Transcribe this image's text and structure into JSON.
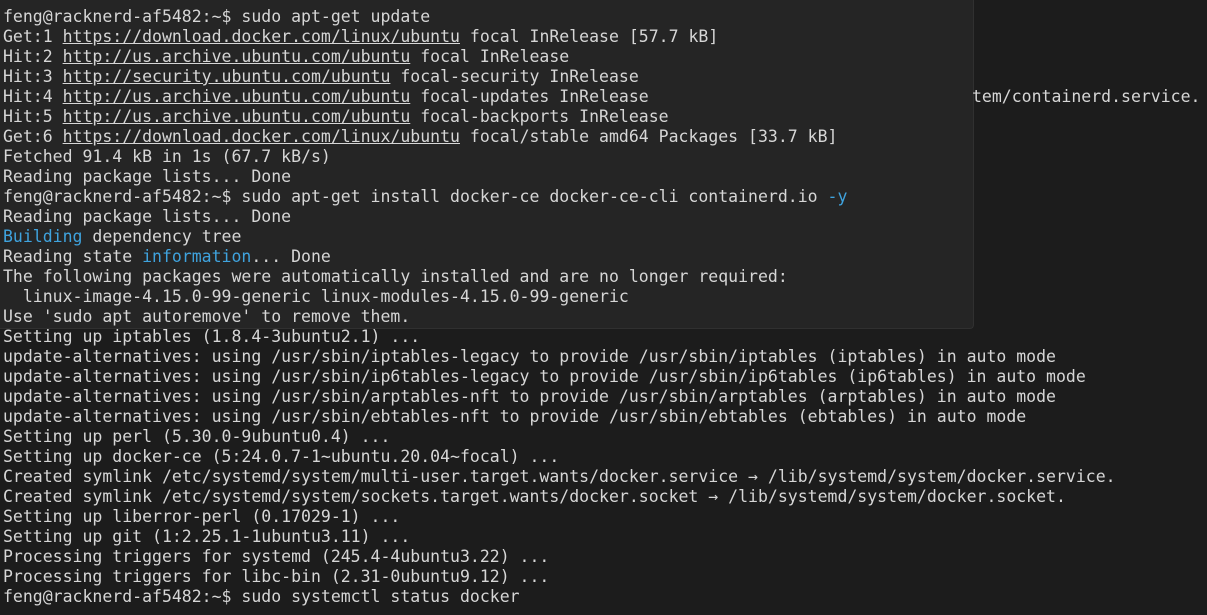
{
  "terminal": {
    "lines": [
      [
        {
          "t": "feng@racknerd-af5482:~$ sudo apt-get update"
        }
      ],
      [
        {
          "t": "Get:1 "
        },
        {
          "t": "https://download.docker.com/linux/ubuntu",
          "s": "url"
        },
        {
          "t": " focal InRelease [57.7 kB]"
        }
      ],
      [
        {
          "t": "Hit:2 "
        },
        {
          "t": "http://us.archive.ubuntu.com/ubuntu",
          "s": "url"
        },
        {
          "t": " focal InRelease"
        }
      ],
      [
        {
          "t": "Hit:3 "
        },
        {
          "t": "http://security.ubuntu.com/ubuntu",
          "s": "url"
        },
        {
          "t": " focal-security InRelease"
        }
      ],
      [
        {
          "t": "Hit:4 "
        },
        {
          "t": "http://us.archive.ubuntu.com/ubuntu",
          "s": "url"
        },
        {
          "t": " focal-updates InRelease"
        }
      ],
      [
        {
          "t": "Hit:5 "
        },
        {
          "t": "http://us.archive.ubuntu.com/ubuntu",
          "s": "url"
        },
        {
          "t": " focal-backports InRelease"
        }
      ],
      [
        {
          "t": "Get:6 "
        },
        {
          "t": "https://download.docker.com/linux/ubuntu",
          "s": "url"
        },
        {
          "t": " focal/stable amd64 Packages [33.7 kB]"
        }
      ],
      [
        {
          "t": "Fetched 91.4 kB in 1s (67.7 kB/s)"
        }
      ],
      [
        {
          "t": "Reading package lists... Done"
        }
      ],
      [
        {
          "t": "feng@racknerd-af5482:~$ sudo apt-get install docker-ce docker-ce-cli containerd.io "
        },
        {
          "t": "-y",
          "s": "hl"
        }
      ],
      [
        {
          "t": "Reading package lists... Done"
        }
      ],
      [
        {
          "t": "Building",
          "s": "hl"
        },
        {
          "t": " dependency tree"
        }
      ],
      [
        {
          "t": "Reading state "
        },
        {
          "t": "information",
          "s": "hl"
        },
        {
          "t": "... Done"
        }
      ],
      [
        {
          "t": "The following packages were automatically installed and are no longer required:"
        }
      ],
      [
        {
          "t": "  linux-image-4.15.0-99-generic linux-modules-4.15.0-99-generic"
        }
      ],
      [
        {
          "t": "Use 'sudo apt autoremove' to remove them."
        }
      ],
      [
        {
          "t": "Setting up iptables (1.8.4-3ubuntu2.1) ..."
        }
      ],
      [
        {
          "t": "update-alternatives: using /usr/sbin/iptables-legacy to provide /usr/sbin/iptables (iptables) in auto mode"
        }
      ],
      [
        {
          "t": "update-alternatives: using /usr/sbin/ip6tables-legacy to provide /usr/sbin/ip6tables (ip6tables) in auto mode"
        }
      ],
      [
        {
          "t": "update-alternatives: using /usr/sbin/arptables-nft to provide /usr/sbin/arptables (arptables) in auto mode"
        }
      ],
      [
        {
          "t": "update-alternatives: using /usr/sbin/ebtables-nft to provide /usr/sbin/ebtables (ebtables) in auto mode"
        }
      ],
      [
        {
          "t": "Setting up perl (5.30.0-9ubuntu0.4) ..."
        }
      ],
      [
        {
          "t": "Setting up docker-ce (5:24.0.7-1~ubuntu.20.04~focal) ..."
        }
      ],
      [
        {
          "t": "Created symlink /etc/systemd/system/multi-user.target.wants/docker.service → /lib/systemd/system/docker.service."
        }
      ],
      [
        {
          "t": "Created symlink /etc/systemd/system/sockets.target.wants/docker.socket → /lib/systemd/system/docker.socket."
        }
      ],
      [
        {
          "t": "Setting up liberror-perl (0.17029-1) ..."
        }
      ],
      [
        {
          "t": "Setting up git (1:2.25.1-1ubuntu3.11) ..."
        }
      ],
      [
        {
          "t": "Processing triggers for systemd (245.4-4ubuntu3.22) ..."
        }
      ],
      [
        {
          "t": "Processing triggers for libc-bin (2.31-0ubuntu9.12) ..."
        }
      ],
      [
        {
          "t": "feng@racknerd-af5482:~$ sudo systemctl status docker"
        }
      ]
    ],
    "right_fragment": "tem/containerd.service."
  },
  "colors": {
    "background": "#1c1c1c",
    "overlay_panel": "#252525",
    "text": "#d6d6d6",
    "highlight": "#3fa3de"
  }
}
